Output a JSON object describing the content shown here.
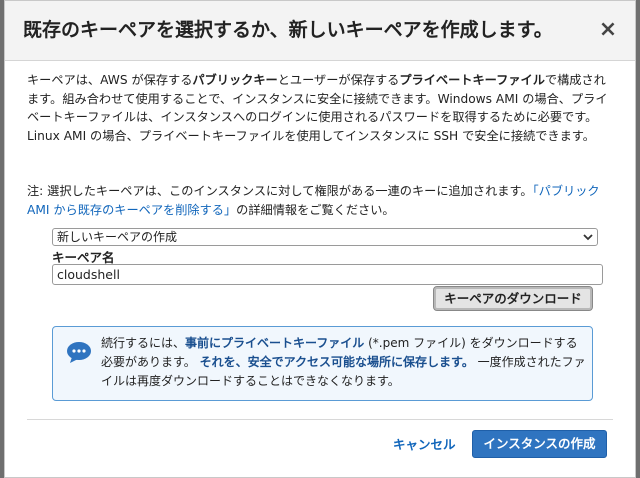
{
  "modal": {
    "title": "既存のキーペアを選択するか、新しいキーペアを作成します。",
    "close_glyph": "×"
  },
  "description": {
    "part1": "キーペアは、AWS が保存する",
    "bold1": "パブリックキー",
    "part2": "とユーザーが保存する",
    "bold2": "プライベートキーファイル",
    "part3": "で構成されます。組み合わせて使用することで、インスタンスに安全に接続できます。Windows AMI の場合、プライベートキーファイルは、インスタンスへのログインに使用されるパスワードを取得するために必要です。Linux AMI の場合、プライベートキーファイルを使用してインスタンスに SSH で安全に接続できます。"
  },
  "note": {
    "prefix": "注: 選択したキーペアは、このインスタンスに対して権限がある一連のキーに追加されます。",
    "link": "「パブリック AMI から既存のキーペアを削除する」",
    "suffix": "の詳細情報をご覧ください。"
  },
  "key_select": {
    "selected": "新しいキーペアの作成"
  },
  "key_name": {
    "label": "キーペア名",
    "value": "cloudshell"
  },
  "download_button": "キーペアのダウンロード",
  "info": {
    "part1": "続行するには、",
    "bold1": "事前にプライベートキーファイル",
    "part2": " (*.pem ファイル) をダウンロードする必要があります。",
    "bold2": "それを、安全でアクセス可能な場所に保存します。",
    "part3": "一度作成されたファイルは再度ダウンロードすることはできなくなります。"
  },
  "footer": {
    "cancel": "キャンセル",
    "create": "インスタンスの作成"
  },
  "colors": {
    "accent": "#2f74c0",
    "link": "#1166bb",
    "info_bg": "#f1f7fd",
    "info_border": "#5a9bd5"
  }
}
